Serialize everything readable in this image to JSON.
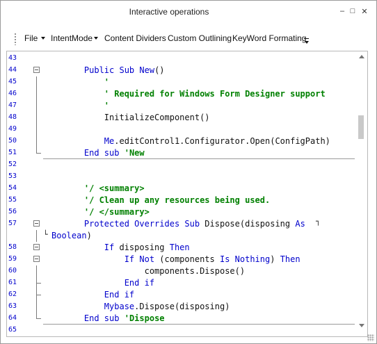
{
  "window": {
    "title": "Interactive operations",
    "minimize_glyph": "–",
    "maximize_glyph": "□",
    "close_glyph": "✕"
  },
  "menu": {
    "items": [
      {
        "label": "File"
      },
      {
        "label": "IntentMode"
      },
      {
        "label": "Content Dividers"
      },
      {
        "label": "Custom Outlining"
      },
      {
        "label": "KeyWord Formating"
      }
    ]
  },
  "editor": {
    "lines": [
      {
        "num": "43",
        "segs": []
      },
      {
        "num": "44",
        "segs": [
          {
            "t": "    "
          },
          {
            "t": "Public Sub New",
            "c": "kw"
          },
          {
            "t": "()"
          }
        ]
      },
      {
        "num": "45",
        "segs": [
          {
            "t": "        "
          },
          {
            "t": "'",
            "c": "cm"
          }
        ]
      },
      {
        "num": "46",
        "segs": [
          {
            "t": "        "
          },
          {
            "t": "' Required for Windows Form Designer support",
            "c": "cm"
          }
        ]
      },
      {
        "num": "47",
        "segs": [
          {
            "t": "        "
          },
          {
            "t": "'",
            "c": "cm"
          }
        ]
      },
      {
        "num": "48",
        "segs": [
          {
            "t": "        InitializeComponent()"
          }
        ]
      },
      {
        "num": "49",
        "segs": []
      },
      {
        "num": "50",
        "segs": [
          {
            "t": "        "
          },
          {
            "t": "Me",
            "c": "kw"
          },
          {
            "t": ".editControl1.Configurator.Open(ConfigPath)"
          }
        ]
      },
      {
        "num": "51",
        "segs": [
          {
            "t": "    "
          },
          {
            "t": "End sub",
            "c": "kw"
          },
          {
            "t": " "
          },
          {
            "t": "'New",
            "c": "cm"
          }
        ]
      },
      {
        "num": "52",
        "segs": []
      },
      {
        "num": "53",
        "segs": []
      },
      {
        "num": "54",
        "segs": [
          {
            "t": "    "
          },
          {
            "t": "'/ <summary>",
            "c": "cm"
          }
        ]
      },
      {
        "num": "55",
        "segs": [
          {
            "t": "    "
          },
          {
            "t": "'/ Clean up any resources being used.",
            "c": "cm"
          }
        ]
      },
      {
        "num": "56",
        "segs": [
          {
            "t": "    "
          },
          {
            "t": "'/ </summary>",
            "c": "cm"
          }
        ]
      },
      {
        "num": "57",
        "segs": [
          {
            "t": "    "
          },
          {
            "t": "Protected Overrides Sub",
            "c": "kw"
          },
          {
            "t": " Dispose(disposing "
          },
          {
            "t": "As",
            "c": "kw"
          }
        ]
      },
      {
        "num": "",
        "segs": [
          {
            "t": "Boolean",
            "c": "kw"
          },
          {
            "t": ")"
          }
        ]
      },
      {
        "num": "58",
        "segs": [
          {
            "t": "        "
          },
          {
            "t": "If",
            "c": "kw"
          },
          {
            "t": " disposing "
          },
          {
            "t": "Then",
            "c": "kw"
          }
        ]
      },
      {
        "num": "59",
        "segs": [
          {
            "t": "            "
          },
          {
            "t": "If Not",
            "c": "kw"
          },
          {
            "t": " (components "
          },
          {
            "t": "Is Nothing",
            "c": "kw"
          },
          {
            "t": ") "
          },
          {
            "t": "Then",
            "c": "kw"
          }
        ]
      },
      {
        "num": "60",
        "segs": [
          {
            "t": "                components.Dispose()"
          }
        ]
      },
      {
        "num": "61",
        "segs": [
          {
            "t": "            "
          },
          {
            "t": "End if",
            "c": "kw"
          }
        ]
      },
      {
        "num": "62",
        "segs": [
          {
            "t": "        "
          },
          {
            "t": "End if",
            "c": "kw"
          }
        ]
      },
      {
        "num": "63",
        "segs": [
          {
            "t": "        "
          },
          {
            "t": "Mybase",
            "c": "kw"
          },
          {
            "t": ".Dispose(disposing)"
          }
        ]
      },
      {
        "num": "64",
        "segs": [
          {
            "t": "    "
          },
          {
            "t": "End sub",
            "c": "kw"
          },
          {
            "t": " "
          },
          {
            "t": "'Dispose",
            "c": "cm"
          }
        ]
      },
      {
        "num": "65",
        "segs": []
      }
    ]
  },
  "colors": {
    "keyword": "#0000cc",
    "comment": "#008000",
    "line_number": "#0000cc"
  }
}
